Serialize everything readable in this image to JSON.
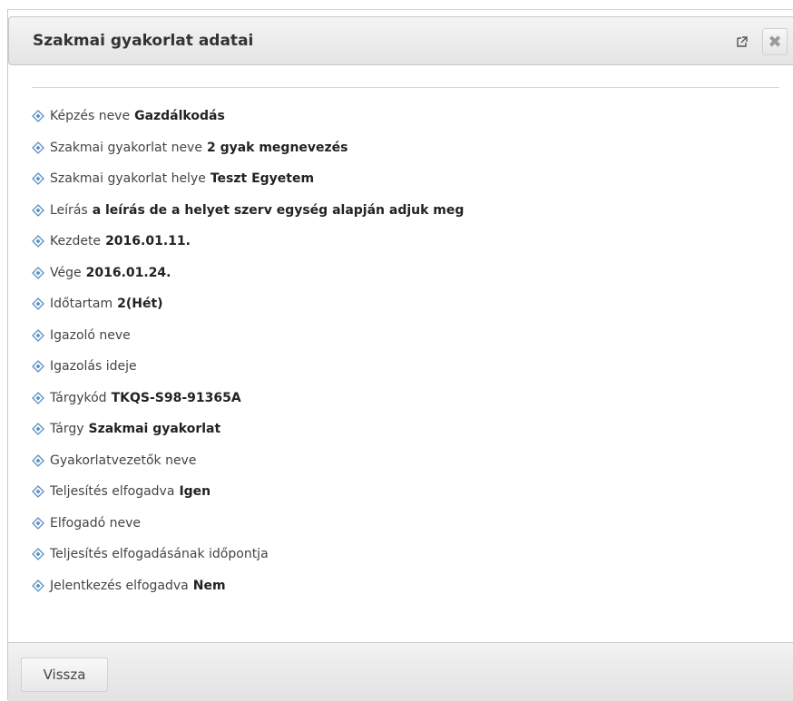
{
  "dialog": {
    "title": "Szakmai gyakorlat adatai",
    "popout_icon": "popout-icon",
    "close_icon": "close-icon",
    "close_glyph": "✖",
    "bullet_icon": "diamond-bullet-icon",
    "accent_color": "#5a8fc4"
  },
  "fields": [
    {
      "label": "Képzés neve",
      "value": "Gazdálkodás"
    },
    {
      "label": "Szakmai gyakorlat neve",
      "value": "2 gyak megnevezés"
    },
    {
      "label": "Szakmai gyakorlat helye",
      "value": "Teszt Egyetem"
    },
    {
      "label": "Leírás",
      "value": "a leírás de a helyet szerv egység alapján adjuk meg"
    },
    {
      "label": "Kezdete",
      "value": "2016.01.11."
    },
    {
      "label": "Vége",
      "value": "2016.01.24."
    },
    {
      "label": "Időtartam",
      "value": "2(Hét)"
    },
    {
      "label": "Igazoló neve",
      "value": ""
    },
    {
      "label": "Igazolás ideje",
      "value": ""
    },
    {
      "label": "Tárgykód",
      "value": "TKQS-S98-91365A"
    },
    {
      "label": "Tárgy",
      "value": "Szakmai gyakorlat"
    },
    {
      "label": "Gyakorlatvezetők neve",
      "value": ""
    },
    {
      "label": "Teljesítés elfogadva",
      "value": "Igen"
    },
    {
      "label": "Elfogadó neve",
      "value": ""
    },
    {
      "label": "Teljesítés elfogadásának időpontja",
      "value": ""
    },
    {
      "label": "Jelentkezés elfogadva",
      "value": "Nem"
    }
  ],
  "footer": {
    "back_label": "Vissza"
  }
}
